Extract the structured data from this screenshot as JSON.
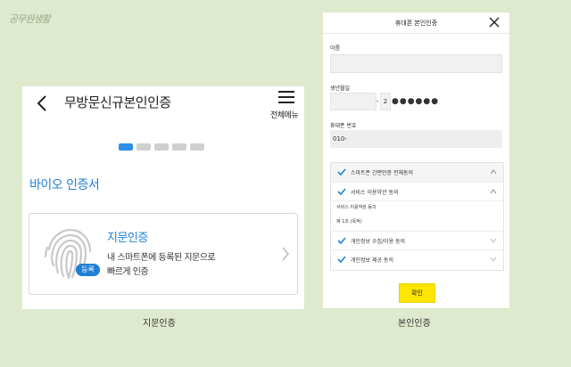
{
  "logo": {
    "text": "공무원생활"
  },
  "left_screen": {
    "title": "무방문신규본인인증",
    "menu_label": "전체메뉴",
    "carousel": {
      "count": 5,
      "active_index": 0
    },
    "section_title": "바이오 인증서",
    "card": {
      "title": "지문인증",
      "desc_line1": "내 스마트폰에 등록된 지문으로",
      "desc_line2": "빠르게 인증",
      "badge": "등록"
    },
    "caption": "지문인증"
  },
  "right_screen": {
    "title": "휴대폰 본인인증",
    "name_label": "이름",
    "name_value": "",
    "birth_label": "생년월일",
    "birth_value": "",
    "gender_digit": "2",
    "masked_value": "●●●●●●",
    "phone_label": "휴대폰 번호",
    "phone_prefix": "010-",
    "agree_all": "스마트폰 간편인증 전체동의",
    "agree_items": [
      {
        "label": "서비스 이용약관 동의"
      },
      {
        "label": "개인정보 수집/이용 동의"
      },
      {
        "label": "개인정보 제공 동의"
      }
    ],
    "terms_title": "서비스 이용약관 동의",
    "terms_article": "제 1조 (목적)",
    "confirm_label": "확인",
    "caption": "본인인증"
  },
  "colors": {
    "background": "#dfe9cd",
    "accent": "#1f7fd8",
    "confirm": "#ffe600"
  }
}
